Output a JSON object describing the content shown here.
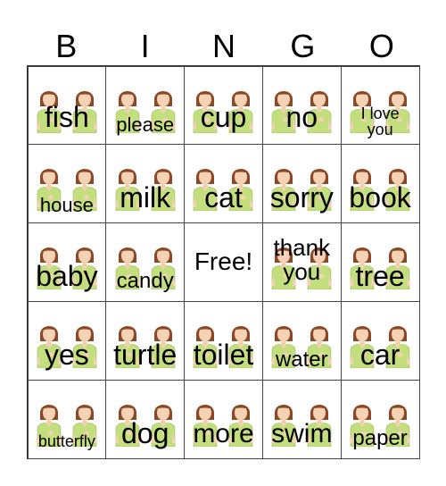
{
  "header": [
    "B",
    "I",
    "N",
    "G",
    "O"
  ],
  "free_label": "Free!",
  "colors": {
    "shirt": "#c3de7d",
    "hair": "#8a4a2a",
    "skin": "#f6d2b4",
    "grid": "#444444"
  },
  "cells": [
    {
      "word": "fish",
      "icon": "sign-fish-icon"
    },
    {
      "word": "please",
      "icon": "sign-please-icon"
    },
    {
      "word": "cup",
      "icon": "sign-cup-icon"
    },
    {
      "word": "no",
      "icon": "sign-no-icon"
    },
    {
      "word": "I love you",
      "icon": "sign-i-love-you-icon"
    },
    {
      "word": "house",
      "icon": "sign-house-icon"
    },
    {
      "word": "milk",
      "icon": "sign-milk-icon"
    },
    {
      "word": "cat",
      "icon": "sign-cat-icon"
    },
    {
      "word": "sorry",
      "icon": "sign-sorry-icon"
    },
    {
      "word": "book",
      "icon": "sign-book-icon"
    },
    {
      "word": "baby",
      "icon": "sign-baby-icon"
    },
    {
      "word": "candy",
      "icon": "sign-candy-icon"
    },
    {
      "free": true
    },
    {
      "word": "thank you",
      "icon": "sign-thank-you-icon"
    },
    {
      "word": "tree",
      "icon": "sign-tree-icon"
    },
    {
      "word": "yes",
      "icon": "sign-yes-icon"
    },
    {
      "word": "turtle",
      "icon": "sign-turtle-icon"
    },
    {
      "word": "toilet",
      "icon": "sign-toilet-icon"
    },
    {
      "word": "water",
      "icon": "sign-water-icon"
    },
    {
      "word": "car",
      "icon": "sign-car-icon"
    },
    {
      "word": "butterfly",
      "icon": "sign-butterfly-icon"
    },
    {
      "word": "dog",
      "icon": "sign-dog-icon"
    },
    {
      "word": "more",
      "icon": "sign-more-icon"
    },
    {
      "word": "swim",
      "icon": "sign-swim-icon"
    },
    {
      "word": "paper",
      "icon": "sign-paper-icon"
    }
  ]
}
